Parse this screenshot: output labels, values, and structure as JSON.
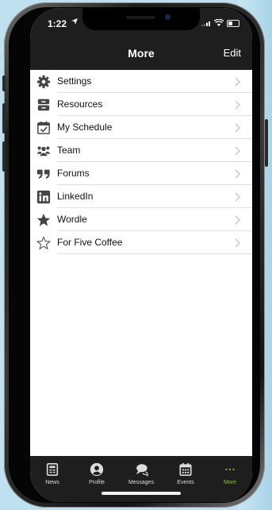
{
  "status_bar": {
    "time": "1:22"
  },
  "nav": {
    "title": "More",
    "edit_label": "Edit"
  },
  "menu_items": [
    {
      "label": "Settings",
      "icon": "gear-icon"
    },
    {
      "label": "Resources",
      "icon": "archive-icon"
    },
    {
      "label": "My Schedule",
      "icon": "calendar-check-icon"
    },
    {
      "label": "Team",
      "icon": "users-icon"
    },
    {
      "label": "Forums",
      "icon": "quote-icon"
    },
    {
      "label": "LinkedIn",
      "icon": "linkedin-icon"
    },
    {
      "label": "Wordle",
      "icon": "star-filled-icon"
    },
    {
      "label": "For Five Coffee",
      "icon": "star-outline-icon"
    }
  ],
  "tabs": [
    {
      "label": "News",
      "icon": "newspaper-icon"
    },
    {
      "label": "Profile",
      "icon": "user-icon"
    },
    {
      "label": "Messages",
      "icon": "chat-icon"
    },
    {
      "label": "Events",
      "icon": "calendar-icon"
    },
    {
      "label": "More",
      "icon": "ellipsis-icon",
      "active": true
    }
  ],
  "colors": {
    "bar_bg": "#1e1e1e",
    "active_tab": "#8bc83f",
    "background": "#bfe0ee"
  }
}
